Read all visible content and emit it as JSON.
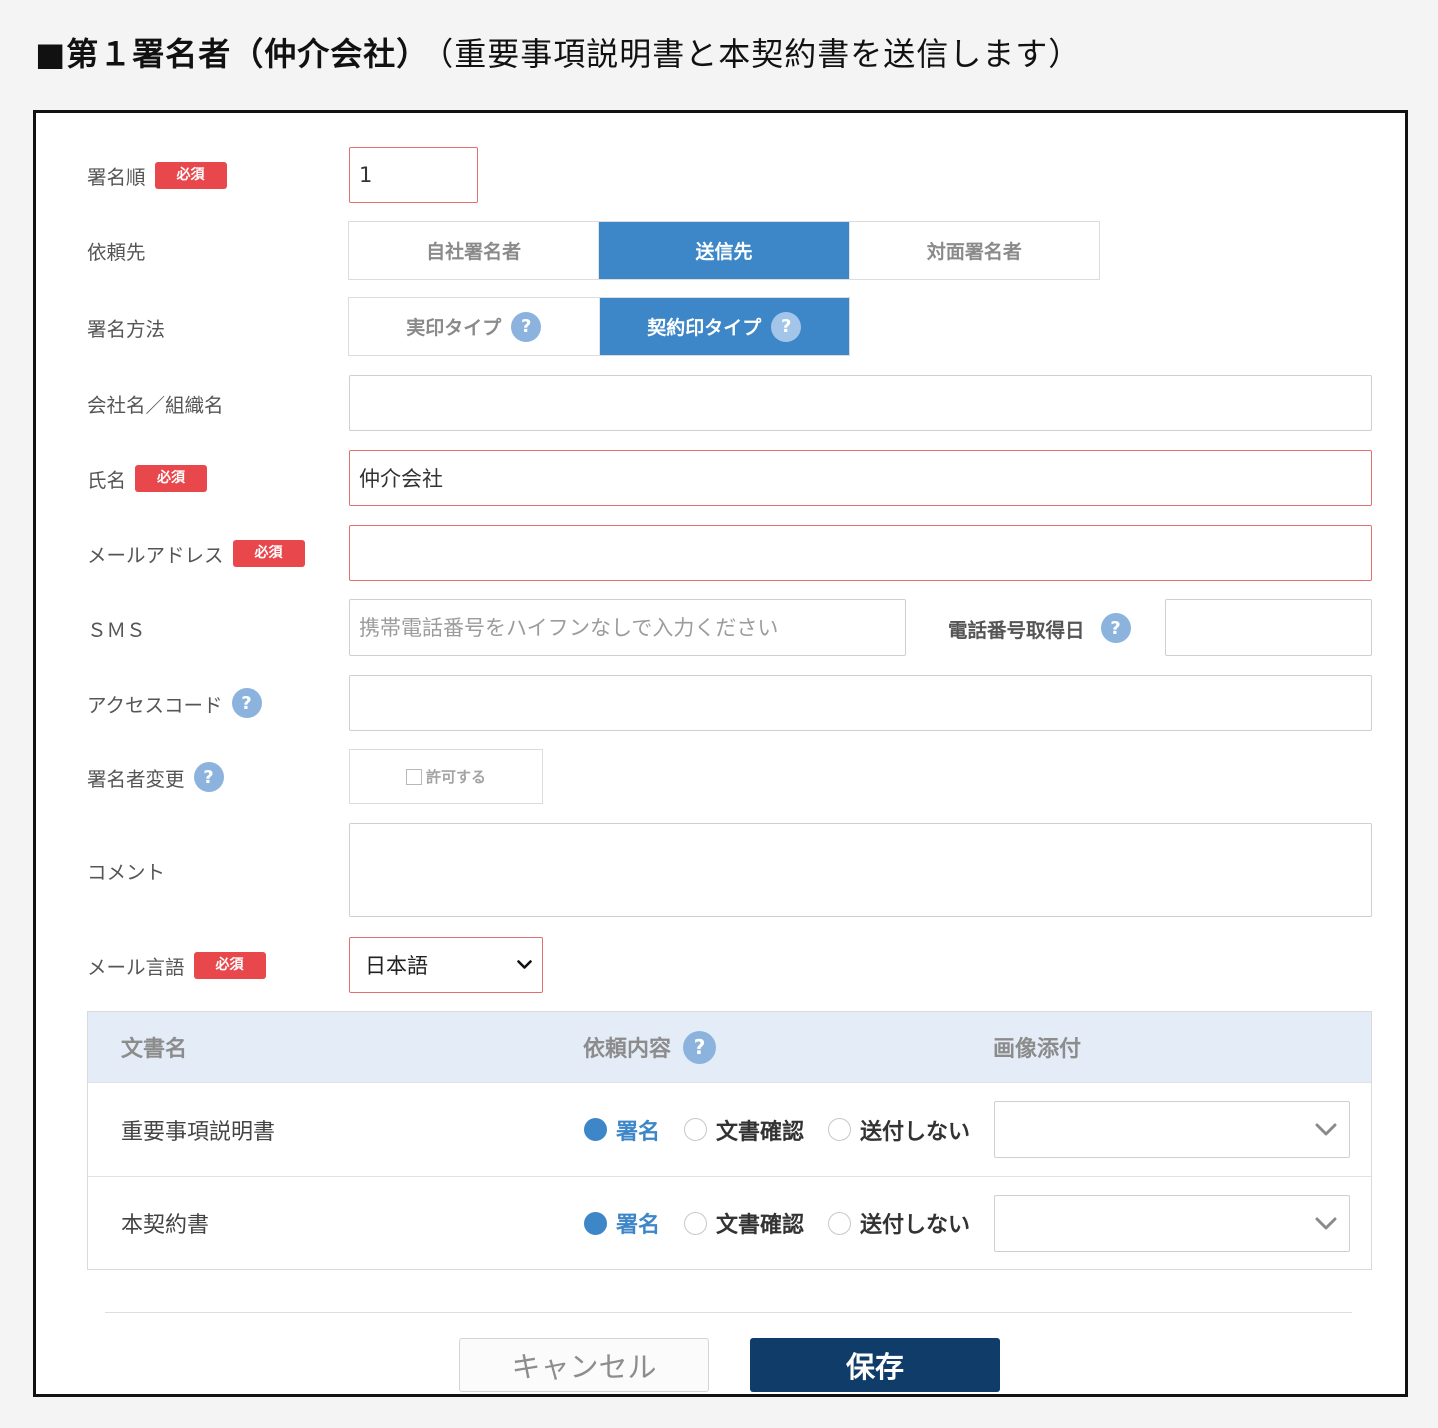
{
  "page": {
    "heading": "■第１署名者（仲介会社）",
    "heading_note": "（重要事項説明書と本契約書を送信します）"
  },
  "form": {
    "required_badge": "必須",
    "sign_order": {
      "label": "署名順",
      "value": "1"
    },
    "request_target": {
      "label": "依頼先",
      "options": [
        "自社署名者",
        "送信先",
        "対面署名者"
      ],
      "selected": "送信先"
    },
    "sign_method": {
      "label": "署名方法",
      "options": [
        "実印タイプ",
        "契約印タイプ"
      ],
      "selected": "契約印タイプ"
    },
    "company": {
      "label": "会社名／組織名",
      "value": ""
    },
    "name": {
      "label": "氏名",
      "value": "仲介会社"
    },
    "email": {
      "label": "メールアドレス",
      "value": ""
    },
    "sms": {
      "label": "ＳＭＳ",
      "value": "",
      "placeholder": "携帯電話番号をハイフンなしで入力ください",
      "date_label": "電話番号取得日",
      "date_value": ""
    },
    "access_code": {
      "label": "アクセスコード",
      "value": ""
    },
    "signer_change": {
      "label": "署名者変更",
      "checkbox_label": "許可する",
      "checked": false
    },
    "comment": {
      "label": "コメント",
      "value": ""
    },
    "mail_language": {
      "label": "メール言語",
      "value": "日本語"
    }
  },
  "documents": {
    "headers": {
      "name": "文書名",
      "request": "依頼内容",
      "image": "画像添付"
    },
    "request_options": [
      "署名",
      "文書確認",
      "送付しない"
    ],
    "rows": [
      {
        "name": "重要事項説明書",
        "request": "署名",
        "image": ""
      },
      {
        "name": "本契約書",
        "request": "署名",
        "image": ""
      }
    ]
  },
  "buttons": {
    "cancel": "キャンセル",
    "save": "保存"
  },
  "icons": {
    "help": "question-circle-icon",
    "dropdown": "chevron-down-icon",
    "checkbox": "checkbox-icon"
  },
  "colors": {
    "accent": "#3d86c8",
    "required": "#e8474b",
    "save_button": "#0f3c69",
    "help_icon": "#8bb3dd",
    "table_header": "#e3ecf7"
  }
}
